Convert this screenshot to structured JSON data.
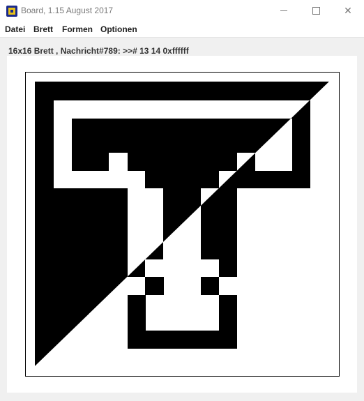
{
  "window": {
    "title": "Board, 1.15 August 2017",
    "app_icon": "board-app-icon",
    "controls": {
      "minimize": "minimize-icon",
      "maximize": "maximize-icon",
      "close": "close-icon",
      "close_glyph": "✕"
    }
  },
  "menu": {
    "items": [
      "Datei",
      "Brett",
      "Formen",
      "Optionen"
    ]
  },
  "status": {
    "message": "16x16 Brett , Nachricht#789: >># 13 14 0xffffff"
  },
  "board": {
    "size": 16,
    "colors": {
      "fill": "#000000",
      "background": "#ffffff"
    }
  }
}
